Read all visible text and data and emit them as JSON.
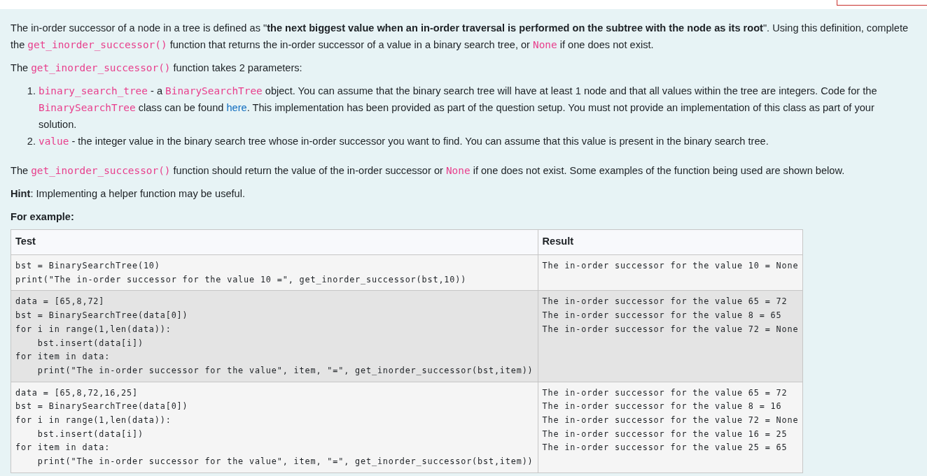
{
  "intro": [
    {
      "kind": "text",
      "text": "The in-order successor of a node in a tree is defined as \""
    },
    {
      "kind": "bold",
      "text": "the next biggest value when an in-order traversal is performed on the subtree with the node as its root"
    },
    {
      "kind": "text",
      "text": "\". Using this definition, complete the "
    },
    {
      "kind": "code",
      "text": "get_inorder_successor()"
    },
    {
      "kind": "text",
      "text": " function that returns the in-order successor of a value in a binary search tree, or "
    },
    {
      "kind": "code",
      "text": "None"
    },
    {
      "kind": "text",
      "text": " if one does not exist."
    }
  ],
  "params_intro": [
    {
      "kind": "text",
      "text": "The "
    },
    {
      "kind": "code",
      "text": "get_inorder_successor()"
    },
    {
      "kind": "text",
      "text": " function takes 2 parameters:"
    }
  ],
  "parameters": [
    {
      "marker": "1.",
      "parts": [
        {
          "kind": "code",
          "text": "binary_search_tree"
        },
        {
          "kind": "text",
          "text": " - a "
        },
        {
          "kind": "code",
          "text": "BinarySearchTree"
        },
        {
          "kind": "text",
          "text": " object. You can assume that the binary search tree will have at least 1 node and that all values within the tree are integers. Code for the "
        },
        {
          "kind": "code",
          "text": "BinarySearchTree"
        },
        {
          "kind": "text",
          "text": " class can be found "
        },
        {
          "kind": "link",
          "text": "here"
        },
        {
          "kind": "text",
          "text": ". This implementation has been provided as part of the question setup. You must not provide an implementation of this class as part of your solution."
        }
      ]
    },
    {
      "marker": "2.",
      "parts": [
        {
          "kind": "code",
          "text": "value"
        },
        {
          "kind": "text",
          "text": " - the integer value in the binary search tree whose in-order successor you want to find. You can assume that this value is present in the binary search tree."
        }
      ]
    }
  ],
  "return_text": [
    {
      "kind": "text",
      "text": "The "
    },
    {
      "kind": "code",
      "text": "get_inorder_successor()"
    },
    {
      "kind": "text",
      "text": " function should return the value of the in-order successor or "
    },
    {
      "kind": "code",
      "text": "None"
    },
    {
      "kind": "text",
      "text": " if one does not exist. Some examples of the function being used are shown below."
    }
  ],
  "hint": [
    {
      "kind": "bold",
      "text": "Hint"
    },
    {
      "kind": "text",
      "text": ": Implementing a helper function may be useful."
    }
  ],
  "example_label": "For example:",
  "table": {
    "columns": [
      "Test",
      "Result"
    ],
    "rows": [
      {
        "test": [
          "bst = BinarySearchTree(10)",
          "print(\"The in-order successor for the value 10 =\", get_inorder_successor(bst,10))"
        ],
        "result": [
          "The in-order successor for the value 10 = None"
        ]
      },
      {
        "test": [
          "data = [65,8,72]",
          "bst = BinarySearchTree(data[0])",
          "for i in range(1,len(data)):",
          "    bst.insert(data[i])",
          "for item in data:",
          "    print(\"The in-order successor for the value\", item, \"=\", get_inorder_successor(bst,item))"
        ],
        "result": [
          "The in-order successor for the value 65 = 72",
          "The in-order successor for the value 8 = 65",
          "The in-order successor for the value 72 = None"
        ]
      },
      {
        "test": [
          "data = [65,8,72,16,25]",
          "bst = BinarySearchTree(data[0])",
          "for i in range(1,len(data)):",
          "    bst.insert(data[i])",
          "for item in data:",
          "    print(\"The in-order successor for the value\", item, \"=\", get_inorder_successor(bst,item))"
        ],
        "result": [
          "The in-order successor for the value 65 = 72",
          "The in-order successor for the value 8 = 16",
          "The in-order successor for the value 72 = None",
          "The in-order successor for the value 16 = 25",
          "The in-order successor for the value 25 = 65"
        ]
      }
    ]
  }
}
